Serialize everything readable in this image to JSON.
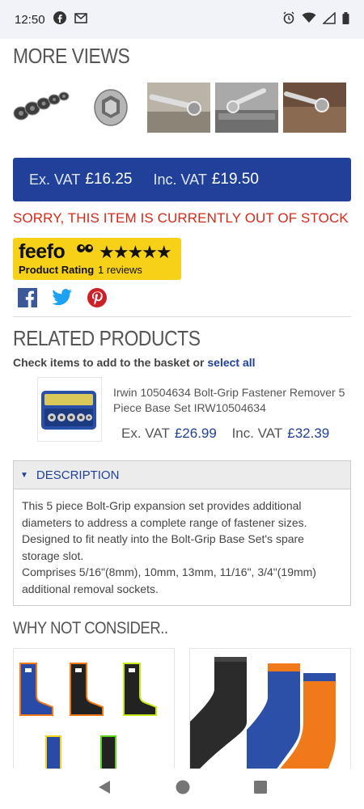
{
  "status_bar": {
    "time": "12:50",
    "left_icons": [
      "facebook-icon",
      "mail-icon"
    ],
    "right_icons": [
      "alarm-icon",
      "wifi-icon",
      "signal-icon",
      "battery-icon"
    ]
  },
  "more_views": {
    "title": "MORE VIEWS",
    "thumbnails": [
      "thumb-sockets-set",
      "thumb-single-socket",
      "thumb-socket-wrench",
      "thumb-wrench-rail",
      "thumb-wrench-bolt"
    ]
  },
  "price": {
    "ex_label": "Ex. VAT",
    "ex_value": "£16.25",
    "inc_label": "Inc. VAT",
    "inc_value": "£19.50"
  },
  "stock_message": "SORRY, THIS ITEM IS CURRENTLY OUT OF STOCK",
  "feefo": {
    "logo": "feefo",
    "stars": "★★★★★",
    "rating_label": "Product Rating",
    "reviews": "1  reviews"
  },
  "social": [
    "facebook-share-icon",
    "twitter-share-icon",
    "pinterest-share-icon"
  ],
  "related": {
    "title": "RELATED PRODUCTS",
    "check_prefix": "Check items to add to the basket or",
    "select_all": "select all",
    "item": {
      "name": "Irwin 10504634 Bolt-Grip Fastener Remover 5 Piece Base Set IRW10504634",
      "ex_label": "Ex. VAT",
      "ex_value": "£26.99",
      "inc_label": "Inc. VAT",
      "inc_value": "£32.39"
    }
  },
  "description": {
    "heading": "DESCRIPTION",
    "text_1": "This 5 piece Bolt-Grip expansion set provides additional diameters to address a complete range of fastener sizes. Designed to fit neatly into the Bolt-Grip Base Set's spare storage slot.",
    "text_2": "Comprises 5/16\"(8mm), 10mm, 13mm, 11/16\", 3/4\"(19mm) additional removal sockets."
  },
  "consider": {
    "title": "WHY NOT CONSIDER.."
  },
  "colors": {
    "brand_blue": "#21409a",
    "stock_red": "#d42a1a",
    "feefo_yellow": "#f7d117"
  }
}
